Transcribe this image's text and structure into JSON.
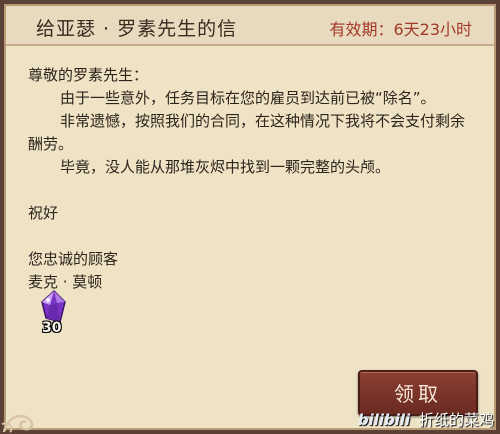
{
  "letter": {
    "title": "给亚瑟 · 罗素先生的信",
    "validity": "有效期：6天23小时",
    "salutation": "尊敬的罗素先生：",
    "paragraphs": [
      "由于一些意外，任务目标在您的雇员到达前已被“除名”。",
      "非常遗憾，按照我们的合同，在这种情况下我将不会支付剩余酬劳。",
      "毕竟，没人能从那堆灰烬中找到一颗完整的头颅。"
    ],
    "closing": "祝好",
    "sign_line_1": "您忠诚的顾客",
    "sign_line_2": "麦克 · 莫顿"
  },
  "reward": {
    "icon": "purple-crystal-icon",
    "count": "30"
  },
  "claim_button": {
    "label": "领取"
  },
  "watermark": {
    "logo": "bilibili",
    "text": "折纸的菜鸡"
  },
  "colors": {
    "paper": "#efe3c6",
    "validity": "#a33a28",
    "button": "#7a3429",
    "crystal": "#8a3fd0"
  }
}
